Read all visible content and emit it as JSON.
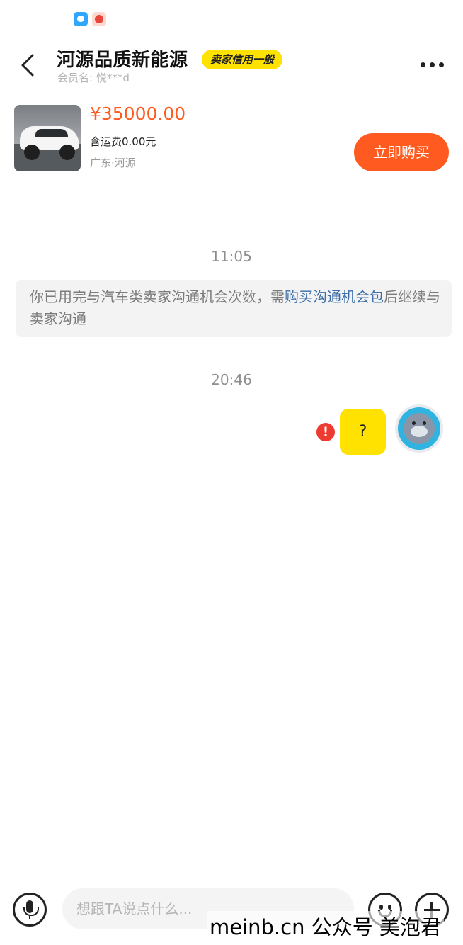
{
  "status_bar": {
    "icons": [
      "chat-app-icon",
      "taobao-app-icon"
    ]
  },
  "header": {
    "back_icon": "chevron-left-icon",
    "title": "河源品质新能源",
    "credit_badge": "卖家信用一般",
    "member_label": "会员名: 悦***d",
    "more_icon": "more-dots-icon"
  },
  "product": {
    "price": "¥35000.00",
    "shipping": "含运费0.00元",
    "location": "广东·河源",
    "buy_label": "立即购买",
    "accent_color": "#ff5a1f"
  },
  "chat": {
    "time1": "11:05",
    "notice_text": "你已用完与汽车类卖家沟通机会次数，需",
    "notice_link": "购买沟通机会包",
    "notice_suffix": "后继续与卖家沟通",
    "time2": "20:46",
    "message_text": "?",
    "message_status": "send-failed",
    "error_glyph": "!"
  },
  "input_bar": {
    "voice_icon": "microphone-icon",
    "placeholder": "想跟TA说点什么...",
    "emoji_icon": "emoji-icon",
    "plus_icon": "plus-icon"
  },
  "watermark": "meinb.cn 公众号 美泡君",
  "colors": {
    "bubble": "#ffe200",
    "link": "#3b6ea8",
    "error": "#ee3b32"
  }
}
